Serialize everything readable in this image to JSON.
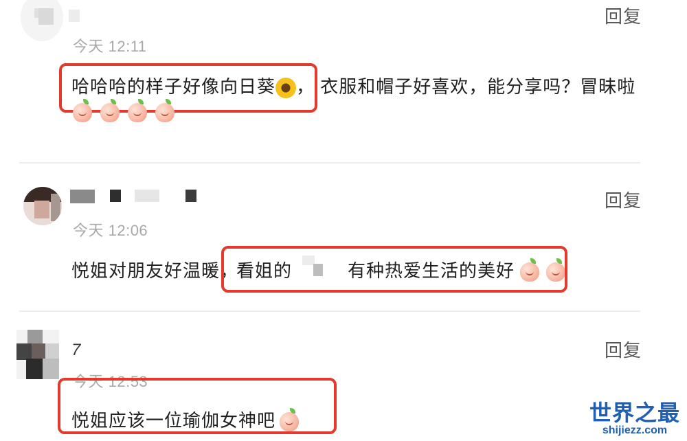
{
  "comments": [
    {
      "time": "今天 12:11",
      "reply": "回复",
      "text_boxed": "哈哈哈的样子好像向日葵",
      "text_rest": "，  衣服和帽子好喜欢，能分享吗？冒昧啦",
      "emoji_row": [
        "peach-kiss",
        "peach-kiss",
        "peach-shy",
        "peach-shy"
      ]
    },
    {
      "time": "今天 12:06",
      "reply": "回复",
      "text_lead": "悦姐对朋友好温暖，",
      "text_boxed_a": "看姐的",
      "text_boxed_b": "有种热爱生活的美好"
    },
    {
      "username": "7",
      "time": "今天 12:53",
      "reply": "回复",
      "text_boxed": "悦姐应该一位瑜伽女神吧"
    }
  ],
  "watermark": {
    "cn": "世界之最",
    "en": "shijiezz.com"
  },
  "colors": {
    "highlight": "#e23b2e",
    "watermark": "#1f5fb4",
    "time": "#a8a8a8"
  }
}
